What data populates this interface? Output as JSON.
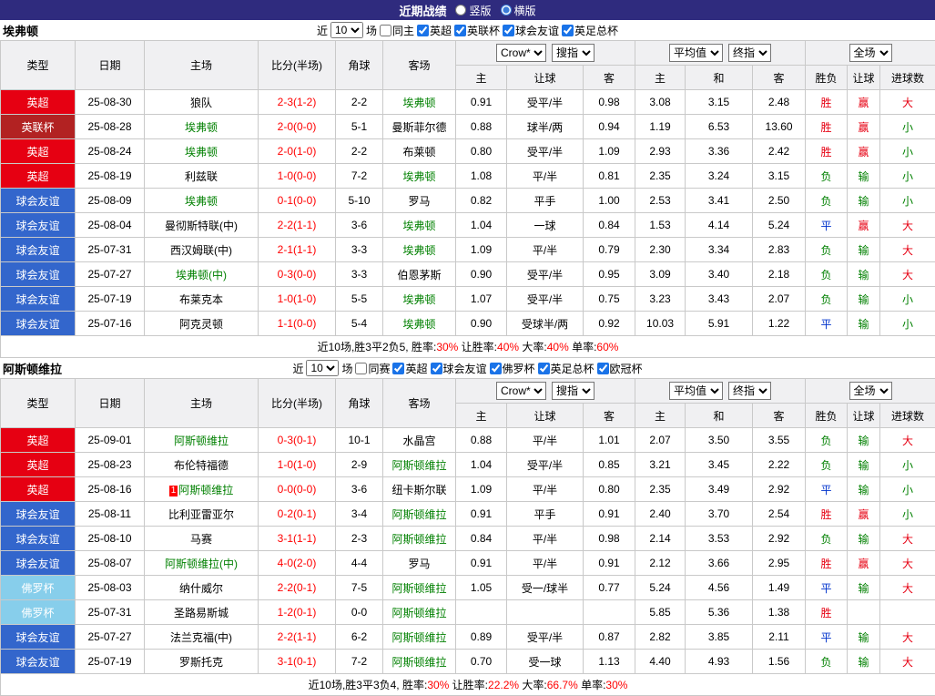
{
  "topbar": {
    "title": "近期战绩",
    "options": [
      {
        "label": "竖版",
        "checked": false
      },
      {
        "label": "横版",
        "checked": true
      }
    ]
  },
  "colors": {
    "topbar_bg": "#2f2b7e",
    "type": {
      "英超": "#e60012",
      "英联杯": "#b22222",
      "球会友谊": "#3366cc",
      "佛罗杯": "#87ceeb"
    },
    "result": {
      "胜": "#e60012",
      "负": "#008000",
      "平": "#0033cc",
      "赢": "#e60012",
      "输": "#008000",
      "大": "#e60012",
      "小": "#008000"
    },
    "focal_team": "#008000",
    "score": "#ff0000"
  },
  "table_header": {
    "main_cols": [
      "类型",
      "日期",
      "主场",
      "比分(半场)",
      "角球",
      "客场"
    ],
    "dropdown_groups": [
      [
        "Crow*",
        "搜指"
      ],
      [
        "平均值",
        "终指"
      ],
      [
        "全场"
      ]
    ],
    "sub_cols": [
      "主",
      "让球",
      "客",
      "主",
      "和",
      "客",
      "胜负",
      "让球",
      "进球数"
    ]
  },
  "sections": [
    {
      "team": "埃弗顿",
      "filter": {
        "near": "近",
        "count": "10",
        "games": "场",
        "unchecked": [
          "同主"
        ],
        "checked": [
          "英超",
          "英联杯",
          "球会友谊",
          "英足总杯"
        ]
      },
      "rows": [
        {
          "type": "英超",
          "date": "25-08-30",
          "home": "狼队",
          "hf": false,
          "score": "2-3(1-2)",
          "corner": "2-2",
          "away": "埃弗顿",
          "af": true,
          "o1": "0.91",
          "hcp": "受平/半",
          "o2": "0.98",
          "m1": "3.08",
          "m2": "3.15",
          "m3": "2.48",
          "r1": "胜",
          "r2": "赢",
          "r3": "大"
        },
        {
          "type": "英联杯",
          "date": "25-08-28",
          "home": "埃弗顿",
          "hf": true,
          "score": "2-0(0-0)",
          "corner": "5-1",
          "away": "曼斯菲尔德",
          "af": false,
          "o1": "0.88",
          "hcp": "球半/两",
          "o2": "0.94",
          "m1": "1.19",
          "m2": "6.53",
          "m3": "13.60",
          "r1": "胜",
          "r2": "赢",
          "r3": "小"
        },
        {
          "type": "英超",
          "date": "25-08-24",
          "home": "埃弗顿",
          "hf": true,
          "score": "2-0(1-0)",
          "corner": "2-2",
          "away": "布莱顿",
          "af": false,
          "o1": "0.80",
          "hcp": "受平/半",
          "o2": "1.09",
          "m1": "2.93",
          "m2": "3.36",
          "m3": "2.42",
          "r1": "胜",
          "r2": "赢",
          "r3": "小"
        },
        {
          "type": "英超",
          "date": "25-08-19",
          "home": "利兹联",
          "hf": false,
          "score": "1-0(0-0)",
          "corner": "7-2",
          "away": "埃弗顿",
          "af": true,
          "o1": "1.08",
          "hcp": "平/半",
          "o2": "0.81",
          "m1": "2.35",
          "m2": "3.24",
          "m3": "3.15",
          "r1": "负",
          "r2": "输",
          "r3": "小"
        },
        {
          "type": "球会友谊",
          "date": "25-08-09",
          "home": "埃弗顿",
          "hf": true,
          "score": "0-1(0-0)",
          "corner": "5-10",
          "away": "罗马",
          "af": false,
          "o1": "0.82",
          "hcp": "平手",
          "o2": "1.00",
          "m1": "2.53",
          "m2": "3.41",
          "m3": "2.50",
          "r1": "负",
          "r2": "输",
          "r3": "小"
        },
        {
          "type": "球会友谊",
          "date": "25-08-04",
          "home": "曼彻斯特联(中)",
          "hf": false,
          "score": "2-2(1-1)",
          "corner": "3-6",
          "away": "埃弗顿",
          "af": true,
          "o1": "1.04",
          "hcp": "一球",
          "o2": "0.84",
          "m1": "1.53",
          "m2": "4.14",
          "m3": "5.24",
          "r1": "平",
          "r2": "赢",
          "r3": "大"
        },
        {
          "type": "球会友谊",
          "date": "25-07-31",
          "home": "西汉姆联(中)",
          "hf": false,
          "score": "2-1(1-1)",
          "corner": "3-3",
          "away": "埃弗顿",
          "af": true,
          "o1": "1.09",
          "hcp": "平/半",
          "o2": "0.79",
          "m1": "2.30",
          "m2": "3.34",
          "m3": "2.83",
          "r1": "负",
          "r2": "输",
          "r3": "大"
        },
        {
          "type": "球会友谊",
          "date": "25-07-27",
          "home": "埃弗顿(中)",
          "hf": true,
          "score": "0-3(0-0)",
          "corner": "3-3",
          "away": "伯恩茅斯",
          "af": false,
          "o1": "0.90",
          "hcp": "受平/半",
          "o2": "0.95",
          "m1": "3.09",
          "m2": "3.40",
          "m3": "2.18",
          "r1": "负",
          "r2": "输",
          "r3": "大"
        },
        {
          "type": "球会友谊",
          "date": "25-07-19",
          "home": "布莱克本",
          "hf": false,
          "score": "1-0(1-0)",
          "corner": "5-5",
          "away": "埃弗顿",
          "af": true,
          "o1": "1.07",
          "hcp": "受平/半",
          "o2": "0.75",
          "m1": "3.23",
          "m2": "3.43",
          "m3": "2.07",
          "r1": "负",
          "r2": "输",
          "r3": "小"
        },
        {
          "type": "球会友谊",
          "date": "25-07-16",
          "home": "阿克灵顿",
          "hf": false,
          "score": "1-1(0-0)",
          "corner": "5-4",
          "away": "埃弗顿",
          "af": true,
          "o1": "0.90",
          "hcp": "受球半/两",
          "o2": "0.92",
          "m1": "10.03",
          "m2": "5.91",
          "m3": "1.22",
          "r1": "平",
          "r2": "输",
          "r3": "小"
        }
      ],
      "summary": [
        {
          "text": "近10场,胜3平2负5, 胜率:",
          "red": false
        },
        {
          "text": "30%",
          "red": true
        },
        {
          "text": " 让胜率:",
          "red": false
        },
        {
          "text": "40%",
          "red": true
        },
        {
          "text": " 大率:",
          "red": false
        },
        {
          "text": "40%",
          "red": true
        },
        {
          "text": " 单率:",
          "red": false
        },
        {
          "text": "60%",
          "red": true
        }
      ]
    },
    {
      "team": "阿斯顿维拉",
      "filter": {
        "near": "近",
        "count": "10",
        "games": "场",
        "unchecked": [
          "同赛"
        ],
        "checked": [
          "英超",
          "球会友谊",
          "佛罗杯",
          "英足总杯",
          "欧冠杯"
        ]
      },
      "rows": [
        {
          "type": "英超",
          "date": "25-09-01",
          "home": "阿斯顿维拉",
          "hf": true,
          "score": "0-3(0-1)",
          "corner": "10-1",
          "away": "水晶宫",
          "af": false,
          "o1": "0.88",
          "hcp": "平/半",
          "o2": "1.01",
          "m1": "2.07",
          "m2": "3.50",
          "m3": "3.55",
          "r1": "负",
          "r2": "输",
          "r3": "大"
        },
        {
          "type": "英超",
          "date": "25-08-23",
          "home": "布伦特福德",
          "hf": false,
          "score": "1-0(1-0)",
          "corner": "2-9",
          "away": "阿斯顿维拉",
          "af": true,
          "o1": "1.04",
          "hcp": "受平/半",
          "o2": "0.85",
          "m1": "3.21",
          "m2": "3.45",
          "m3": "2.22",
          "r1": "负",
          "r2": "输",
          "r3": "小"
        },
        {
          "type": "英超",
          "date": "25-08-16",
          "home": "阿斯顿维拉",
          "hf": true,
          "badge": "1",
          "score": "0-0(0-0)",
          "corner": "3-6",
          "away": "纽卡斯尔联",
          "af": false,
          "o1": "1.09",
          "hcp": "平/半",
          "o2": "0.80",
          "m1": "2.35",
          "m2": "3.49",
          "m3": "2.92",
          "r1": "平",
          "r2": "输",
          "r3": "小"
        },
        {
          "type": "球会友谊",
          "date": "25-08-11",
          "home": "比利亚雷亚尔",
          "hf": false,
          "score": "0-2(0-1)",
          "corner": "3-4",
          "away": "阿斯顿维拉",
          "af": true,
          "o1": "0.91",
          "hcp": "平手",
          "o2": "0.91",
          "m1": "2.40",
          "m2": "3.70",
          "m3": "2.54",
          "r1": "胜",
          "r2": "赢",
          "r3": "小"
        },
        {
          "type": "球会友谊",
          "date": "25-08-10",
          "home": "马赛",
          "hf": false,
          "score": "3-1(1-1)",
          "corner": "2-3",
          "away": "阿斯顿维拉",
          "af": true,
          "o1": "0.84",
          "hcp": "平/半",
          "o2": "0.98",
          "m1": "2.14",
          "m2": "3.53",
          "m3": "2.92",
          "r1": "负",
          "r2": "输",
          "r3": "大"
        },
        {
          "type": "球会友谊",
          "date": "25-08-07",
          "home": "阿斯顿维拉(中)",
          "hf": true,
          "score": "4-0(2-0)",
          "corner": "4-4",
          "away": "罗马",
          "af": false,
          "o1": "0.91",
          "hcp": "平/半",
          "o2": "0.91",
          "m1": "2.12",
          "m2": "3.66",
          "m3": "2.95",
          "r1": "胜",
          "r2": "赢",
          "r3": "大"
        },
        {
          "type": "佛罗杯",
          "date": "25-08-03",
          "home": "纳什威尔",
          "hf": false,
          "score": "2-2(0-1)",
          "corner": "7-5",
          "away": "阿斯顿维拉",
          "af": true,
          "o1": "1.05",
          "hcp": "受一/球半",
          "o2": "0.77",
          "m1": "5.24",
          "m2": "4.56",
          "m3": "1.49",
          "r1": "平",
          "r2": "输",
          "r3": "大"
        },
        {
          "type": "佛罗杯",
          "date": "25-07-31",
          "home": "圣路易斯城",
          "hf": false,
          "score": "1-2(0-1)",
          "corner": "0-0",
          "away": "阿斯顿维拉",
          "af": true,
          "o1": "",
          "hcp": "",
          "o2": "",
          "m1": "5.85",
          "m2": "5.36",
          "m3": "1.38",
          "r1": "胜",
          "r2": "",
          "r3": ""
        },
        {
          "type": "球会友谊",
          "date": "25-07-27",
          "home": "法兰克福(中)",
          "hf": false,
          "score": "2-2(1-1)",
          "corner": "6-2",
          "away": "阿斯顿维拉",
          "af": true,
          "o1": "0.89",
          "hcp": "受平/半",
          "o2": "0.87",
          "m1": "2.82",
          "m2": "3.85",
          "m3": "2.11",
          "r1": "平",
          "r2": "输",
          "r3": "大"
        },
        {
          "type": "球会友谊",
          "date": "25-07-19",
          "home": "罗斯托克",
          "hf": false,
          "score": "3-1(0-1)",
          "corner": "7-2",
          "away": "阿斯顿维拉",
          "af": true,
          "o1": "0.70",
          "hcp": "受一球",
          "o2": "1.13",
          "m1": "4.40",
          "m2": "4.93",
          "m3": "1.56",
          "r1": "负",
          "r2": "输",
          "r3": "大"
        }
      ],
      "summary": [
        {
          "text": "近10场,胜3平3负4, 胜率:",
          "red": false
        },
        {
          "text": "30%",
          "red": true
        },
        {
          "text": " 让胜率:",
          "red": false
        },
        {
          "text": "22.2%",
          "red": true
        },
        {
          "text": " 大率:",
          "red": false
        },
        {
          "text": "66.7%",
          "red": true
        },
        {
          "text": " 单率:",
          "red": false
        },
        {
          "text": "30%",
          "red": true
        }
      ]
    }
  ]
}
